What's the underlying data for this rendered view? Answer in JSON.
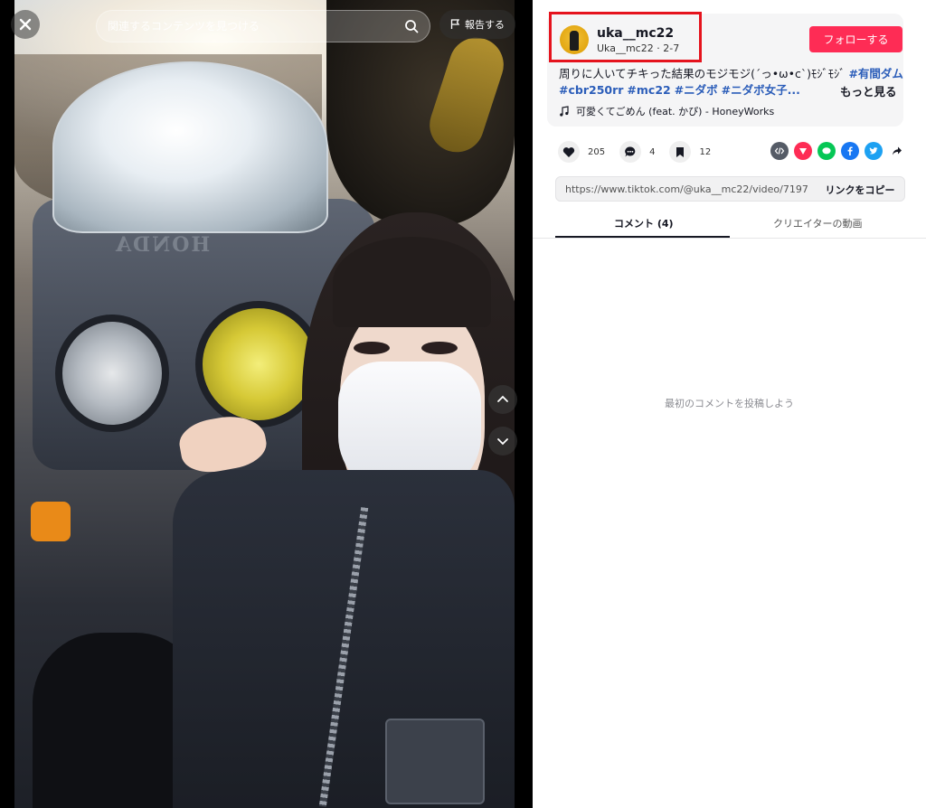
{
  "video": {
    "search_placeholder": "関連するコンテンツを見つける",
    "report_label": "報告する",
    "brand_text": "HONDA"
  },
  "creator": {
    "username": "uka__mc22",
    "display_name": "Uka__mc22",
    "date": "2-7",
    "follow_label": "フォローする"
  },
  "description": {
    "text": "周りに人いてチキった結果のモジモジ(ˊっ•ω•cˋ)ﾓｼﾞﾓｼﾞ",
    "tags": [
      "#有間ダム",
      "#cbr250rr",
      "#mc22",
      "#ニダボ",
      "#ニダボ女子..."
    ],
    "more_label": "もっと見る"
  },
  "music": {
    "title": "可愛くてごめん (feat. かぴ) - HoneyWorks"
  },
  "actions": {
    "likes": "205",
    "comments": "4",
    "saves": "12"
  },
  "share_icons": [
    "embed-icon",
    "send-icon",
    "line-icon",
    "facebook-icon",
    "twitter-icon",
    "share-arrow-icon"
  ],
  "colors": {
    "follow": "#fe2c55",
    "tag": "#2b5db9",
    "highlight": "#e5131d"
  },
  "link": {
    "url": "https://www.tiktok.com/@uka__mc22/video/7197...",
    "copy_label": "リンクをコピー"
  },
  "tabs": {
    "comments": "コメント (4)",
    "creator_videos": "クリエイターの動画"
  },
  "comments_empty": "最初のコメントを投稿しよう"
}
